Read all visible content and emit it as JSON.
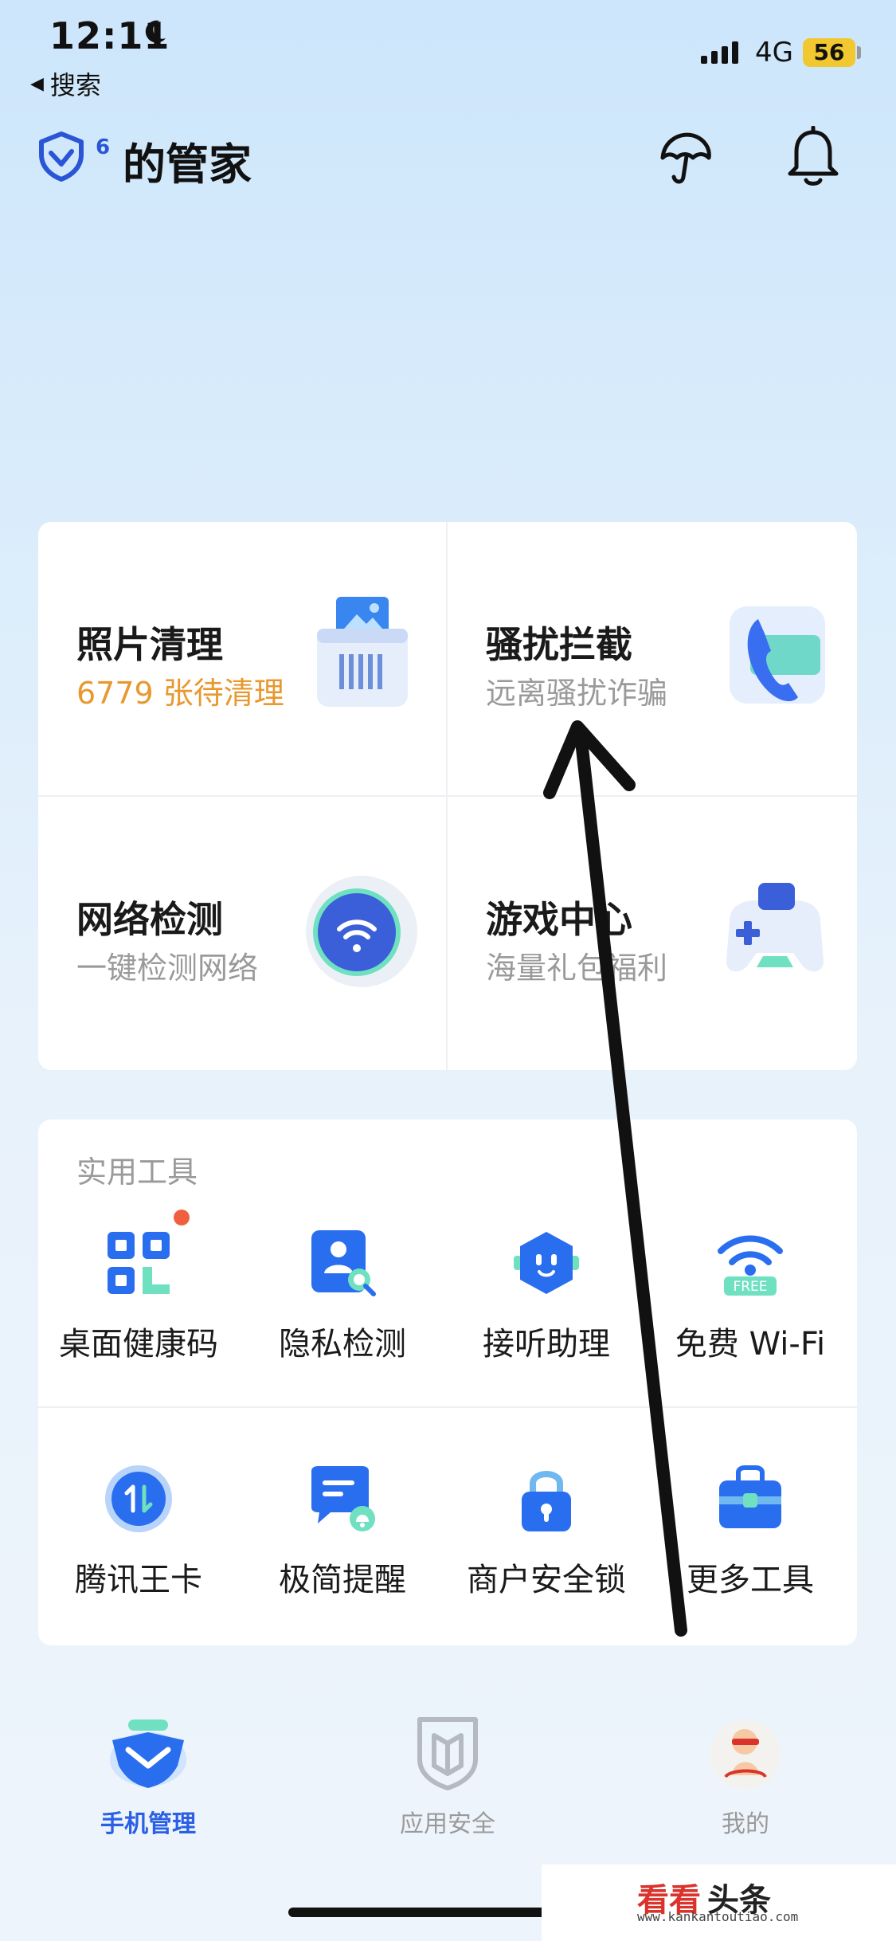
{
  "status_bar": {
    "time": "12:11",
    "back_label": "搜索",
    "network": "4G",
    "battery": "56"
  },
  "header": {
    "badge": "6",
    "title": "的管家"
  },
  "features": [
    {
      "title": "照片清理",
      "subtitle": "6779 张待清理",
      "icon": "photo-shredder-icon"
    },
    {
      "title": "骚扰拦截",
      "subtitle": "远离骚扰诈骗",
      "icon": "phone-block-icon"
    },
    {
      "title": "网络检测",
      "subtitle": "一键检测网络",
      "icon": "wifi-globe-icon"
    },
    {
      "title": "游戏中心",
      "subtitle": "海量礼包福利",
      "icon": "gamepad-icon"
    }
  ],
  "tools": {
    "heading": "实用工具",
    "items": [
      {
        "label": "桌面健康码",
        "icon": "qr-code-icon"
      },
      {
        "label": "隐私检测",
        "icon": "privacy-search-icon"
      },
      {
        "label": "接听助理",
        "icon": "robot-icon"
      },
      {
        "label": "免费 Wi-Fi",
        "icon": "wifi-free-icon",
        "tag": "FREE"
      },
      {
        "label": "腾讯王卡",
        "icon": "card-icon"
      },
      {
        "label": "极简提醒",
        "icon": "reminder-icon"
      },
      {
        "label": "商户安全锁",
        "icon": "lock-icon"
      },
      {
        "label": "更多工具",
        "icon": "toolbox-icon"
      }
    ]
  },
  "bottom_nav": [
    {
      "label": "手机管理",
      "active": true
    },
    {
      "label": "应用安全",
      "active": false
    },
    {
      "label": "我的",
      "active": false
    }
  ],
  "watermark": {
    "brand_red": "看看",
    "brand_dark": "头条",
    "url": "www.kankantoutiao.com"
  },
  "colors": {
    "accent_blue": "#2a5fe6",
    "orange": "#e8982e",
    "muted": "#9a9a9a"
  }
}
